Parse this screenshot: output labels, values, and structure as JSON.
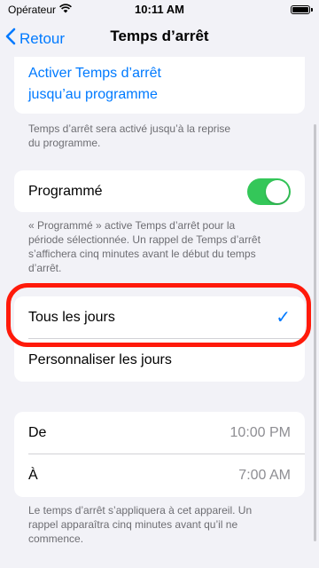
{
  "status": {
    "carrier": "Opérateur",
    "time": "10:11 AM"
  },
  "nav": {
    "back_label": "Retour",
    "title": "Temps d’arrêt"
  },
  "activate": {
    "line1": "Activer Temps d’arrêt",
    "line2": "jusqu’au programme",
    "footer_line1": "Temps d’arrêt sera activé jusqu’à la reprise",
    "footer_line2": "du programme."
  },
  "scheduled": {
    "label": "Programmé",
    "enabled": true,
    "footer_line1": "« Programmé » active Temps d’arrêt pour la",
    "footer_line2": "période sélectionnée. Un rappel de Temps d’arrêt",
    "footer_line3": "s’affichera cinq minutes avant le début du temps",
    "footer_line4": "d’arrêt."
  },
  "days": {
    "every_day": "Tous les jours",
    "custom": "Personnaliser les jours",
    "checkmark": "✓"
  },
  "times": {
    "from_label": "De",
    "from_value": "10:00 PM",
    "to_label": "À",
    "to_value": "7:00 AM",
    "footer_line1": "Le temps d’arrêt s’appliquera à cet appareil. Un",
    "footer_line2": "rappel apparaîtra cinq minutes avant qu’il ne",
    "footer_line3": "commence."
  },
  "colors": {
    "accent": "#007aff",
    "toggle_on": "#34c759",
    "highlight": "#ff1a0a"
  }
}
